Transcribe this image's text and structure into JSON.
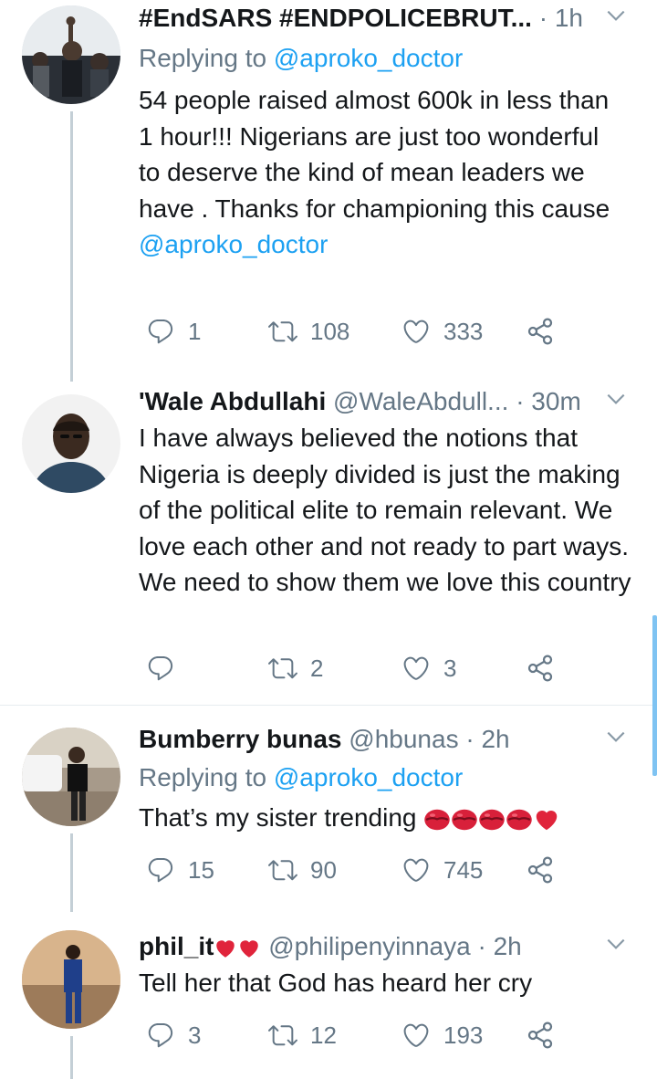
{
  "colors": {
    "accent": "#1da1f2",
    "muted": "#657786",
    "text": "#14171a",
    "thread": "#c4cfd6",
    "divider": "#e6ecf0"
  },
  "tweets": [
    {
      "name": "#EndSARS #ENDPOLICEBRUT...",
      "handle": "",
      "dot": "·",
      "time": "1h",
      "replying_label": "Replying to",
      "replying_to": "@aproko_doctor",
      "text": "54 people raised almost 600k in less than 1 hour!!! Nigerians are just too wonderful to deserve the kind of mean leaders we have . Thanks for championing this cause",
      "trailing_mention": "@aproko_doctor",
      "replies": "1",
      "retweets": "108",
      "likes": "333"
    },
    {
      "name": "'Wale Abdullahi",
      "handle": "@WaleAbdull...",
      "dot": "·",
      "time": "30m",
      "text": "I have always believed the notions that Nigeria is deeply divided is just the making of the political elite to remain relevant. We love each other and not ready to part ways. We need to show them we love this country",
      "replies": "",
      "retweets": "2",
      "likes": "3"
    },
    {
      "name": "Bumberry bunas",
      "handle": "@hbunas",
      "dot": "·",
      "time": "2h",
      "replying_label": "Replying to",
      "replying_to": "@aproko_doctor",
      "text": "That’s my sister trending",
      "emoji_names": [
        "lips-emoji",
        "lips-emoji",
        "lips-emoji",
        "lips-emoji",
        "red-heart-emoji"
      ],
      "replies": "15",
      "retweets": "90",
      "likes": "745"
    },
    {
      "name": "phil_it",
      "name_emoji": [
        "red-heart-emoji",
        "red-heart-emoji"
      ],
      "handle": "@philipenyinnaya",
      "dot": "·",
      "time": "2h",
      "text": "Tell her that God has heard her cry",
      "replies": "3",
      "retweets": "12",
      "likes": "193"
    }
  ]
}
